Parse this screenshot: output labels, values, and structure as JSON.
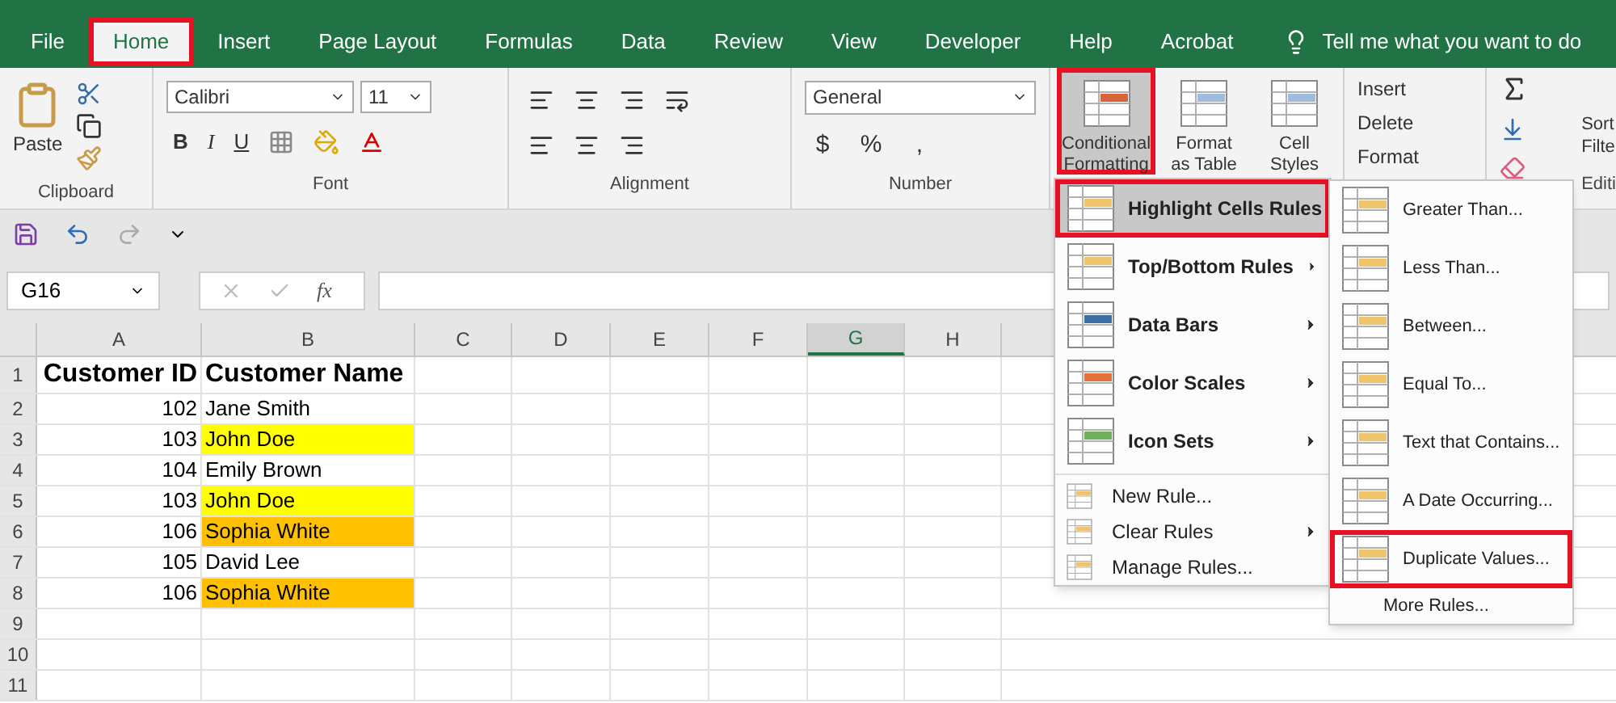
{
  "tabs": [
    {
      "label": "File",
      "selected": false,
      "annotated": false
    },
    {
      "label": "Home",
      "selected": true,
      "annotated": true
    },
    {
      "label": "Insert",
      "selected": false,
      "annotated": false
    },
    {
      "label": "Page Layout",
      "selected": false,
      "annotated": false
    },
    {
      "label": "Formulas",
      "selected": false,
      "annotated": false
    },
    {
      "label": "Data",
      "selected": false,
      "annotated": false
    },
    {
      "label": "Review",
      "selected": false,
      "annotated": false
    },
    {
      "label": "View",
      "selected": false,
      "annotated": false
    },
    {
      "label": "Developer",
      "selected": false,
      "annotated": false
    },
    {
      "label": "Help",
      "selected": false,
      "annotated": false
    },
    {
      "label": "Acrobat",
      "selected": false,
      "annotated": false
    }
  ],
  "tell_me": "Tell me what you want to do",
  "ribbon": {
    "clipboard": {
      "paste": "Paste",
      "label": "Clipboard"
    },
    "font": {
      "name": "Calibri",
      "size": "11",
      "styles": [
        "B",
        "I",
        "U"
      ],
      "label": "Font"
    },
    "alignment": {
      "label": "Alignment"
    },
    "number": {
      "format": "General",
      "symbols": [
        "$",
        "%",
        ","
      ],
      "label": "Number"
    },
    "styles": [
      {
        "label": "Conditional Formatting",
        "annotated": true
      },
      {
        "label": "Format as Table",
        "annotated": false
      },
      {
        "label": "Cell Styles",
        "annotated": false
      }
    ],
    "cells": [
      "Insert",
      "Delete",
      "Format"
    ],
    "editing": {
      "sort": "Sort",
      "filter": "Filte",
      "label": "Editi"
    }
  },
  "formula_bar": {
    "name_box": "G16",
    "function_label": "fx"
  },
  "sheet": {
    "columns": [
      {
        "label": "A",
        "selected": false
      },
      {
        "label": "B",
        "selected": false
      },
      {
        "label": "C",
        "selected": false
      },
      {
        "label": "D",
        "selected": false
      },
      {
        "label": "E",
        "selected": false
      },
      {
        "label": "F",
        "selected": false
      },
      {
        "label": "G",
        "selected": true
      },
      {
        "label": "H",
        "selected": false
      }
    ],
    "rows": [
      {
        "number": "1",
        "id": "Customer ID",
        "name": "Customer Name",
        "header": true
      },
      {
        "number": "2",
        "id": "102",
        "name": "Jane Smith",
        "header": false
      },
      {
        "number": "3",
        "id": "103",
        "name": "John Doe",
        "header": false,
        "color": "#ffff00"
      },
      {
        "number": "4",
        "id": "104",
        "name": "Emily Brown",
        "header": false
      },
      {
        "number": "5",
        "id": "103",
        "name": "John Doe",
        "header": false,
        "color": "#ffff00"
      },
      {
        "number": "6",
        "id": "106",
        "name": "Sophia White",
        "header": false,
        "color": "#ffc000"
      },
      {
        "number": "7",
        "id": "105",
        "name": "David Lee",
        "header": false
      },
      {
        "number": "8",
        "id": "106",
        "name": "Sophia White",
        "header": false,
        "color": "#ffc000"
      },
      {
        "number": "9",
        "header": false
      },
      {
        "number": "10",
        "header": false
      },
      {
        "number": "11",
        "header": false
      }
    ]
  },
  "menu": [
    {
      "kind": "rule",
      "label": "Highlight Cells Rules",
      "submenu": true,
      "selected": true,
      "annotated": true
    },
    {
      "kind": "rule",
      "label": "Top/Bottom Rules",
      "submenu": true,
      "selected": false,
      "annotated": false
    },
    {
      "kind": "rule",
      "label": "Data Bars",
      "submenu": true,
      "selected": false,
      "annotated": false
    },
    {
      "kind": "rule",
      "label": "Color Scales",
      "submenu": true,
      "selected": false,
      "annotated": false
    },
    {
      "kind": "rule",
      "label": "Icon Sets",
      "submenu": true,
      "selected": false,
      "annotated": false
    },
    {
      "kind": "action",
      "label": "New Rule...",
      "submenu": false,
      "selected": false,
      "annotated": false
    },
    {
      "kind": "action",
      "label": "Clear Rules",
      "submenu": true,
      "selected": false,
      "annotated": false
    },
    {
      "kind": "action",
      "label": "Manage Rules...",
      "submenu": false,
      "selected": false,
      "annotated": false
    }
  ],
  "submenu": [
    {
      "kind": "rule",
      "label": "Greater Than...",
      "annotated": false
    },
    {
      "kind": "rule",
      "label": "Less Than...",
      "annotated": false
    },
    {
      "kind": "rule",
      "label": "Between...",
      "annotated": false
    },
    {
      "kind": "rule",
      "label": "Equal To...",
      "annotated": false
    },
    {
      "kind": "rule",
      "label": "Text that Contains...",
      "annotated": false
    },
    {
      "kind": "rule",
      "label": "A Date Occurring...",
      "annotated": false
    },
    {
      "kind": "rule",
      "label": "Duplicate Values...",
      "annotated": true
    },
    {
      "kind": "action",
      "label": "More Rules...",
      "annotated": false
    }
  ]
}
